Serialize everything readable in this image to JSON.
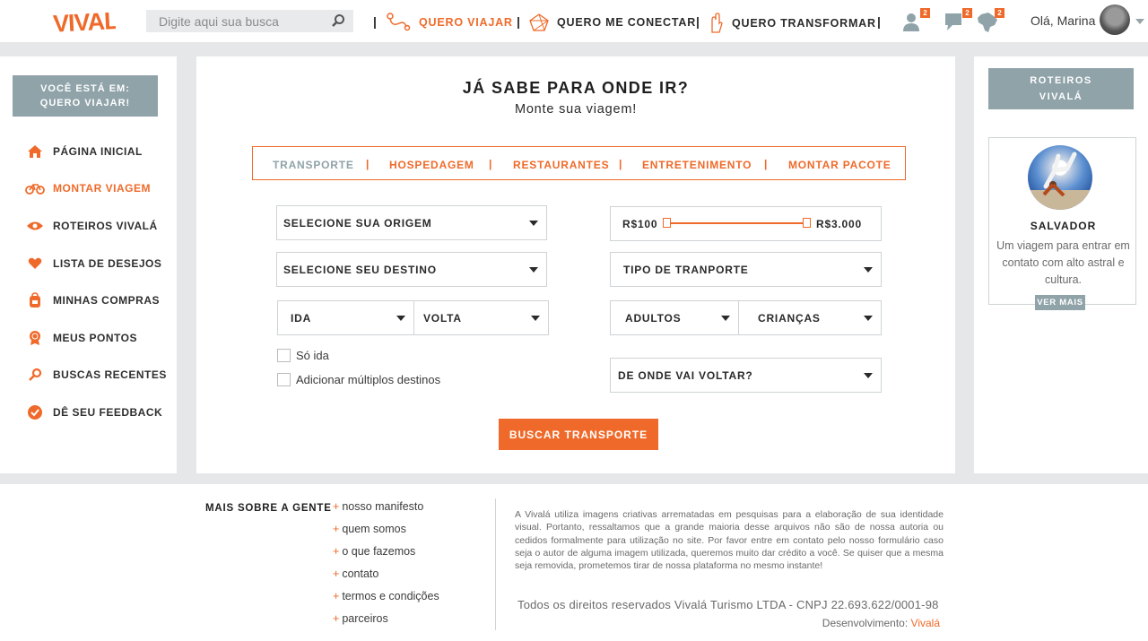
{
  "header": {
    "logo_text": "VIVALÁ",
    "search_placeholder": "Digite aqui sua busca",
    "nav": [
      {
        "label": "QUERO VIAJAR",
        "active": true
      },
      {
        "label": "QUERO ME CONECTAR",
        "active": false
      },
      {
        "label": "QUERO TRANSFORMAR",
        "active": false
      }
    ],
    "badges": {
      "profile": "2",
      "messages": "2",
      "map": "2"
    },
    "greeting": "Olá, Marina"
  },
  "sidebar": {
    "you_are_line1": "VOCÊ ESTÁ EM:",
    "you_are_line2": "QUERO VIAJAR!",
    "items": [
      {
        "label": "PÁGINA INICIAL",
        "icon": "home-icon"
      },
      {
        "label": "MONTAR VIAGEM",
        "icon": "bicycle-icon",
        "active": true
      },
      {
        "label": "ROTEIROS VIVALÁ",
        "icon": "eye-icon"
      },
      {
        "label": "LISTA DE DESEJOS",
        "icon": "heart-icon"
      },
      {
        "label": "MINHAS COMPRAS",
        "icon": "backpack-icon"
      },
      {
        "label": "MEUS PONTOS",
        "icon": "medal-icon"
      },
      {
        "label": "BUSCAS RECENTES",
        "icon": "search-icon"
      },
      {
        "label": "DÊ SEU FEEDBACK",
        "icon": "check-circle-icon"
      }
    ]
  },
  "main": {
    "title": "JÁ SABE PARA ONDE IR?",
    "subtitle": "Monte sua viagem!",
    "tabs": [
      "TRANSPORTE",
      "HOSPEDAGEM",
      "RESTAURANTES",
      "ENTRETENIMENTO",
      "MONTAR PACOTE"
    ],
    "origin": "SELECIONE SUA ORIGEM",
    "destination": "SELECIONE SEU DESTINO",
    "ida": "IDA",
    "volta": "VOLTA",
    "only_ida": "Só ida",
    "multi_dest": "Adicionar múltiplos destinos",
    "price_min": "R$100",
    "price_max": "R$3.000",
    "transport_type": "TIPO DE TRANPORTE",
    "adults": "ADULTOS",
    "children": "CRIANÇAS",
    "return_from": "DE ONDE VAI VOLTAR?",
    "submit": "BUSCAR TRANSPORTE"
  },
  "right": {
    "head_line1": "ROTEIROS",
    "head_line2": "VIVALÁ",
    "card_title": "SALVADOR",
    "card_text": "Um viagem para entrar em contato com alto astral e cultura.",
    "card_button": "VER MAIS"
  },
  "footer": {
    "heading": "MAIS SOBRE A GENTE",
    "links": [
      "nosso manifesto",
      "quem somos",
      "o que fazemos",
      "contato",
      "termos e condições",
      "parceiros"
    ],
    "disclaimer": "A Vivalá utiliza imagens criativas arrematadas em pesquisas para a elaboração de sua identidade visual. Portanto, ressaltamos que a grande maioria desse arquivos não são de nossa autoria ou cedidos formalmente para utilização no site. Por favor entre em contato pelo nosso formulário caso seja o autor de alguma imagem utilizada, queremos muito dar crédito a você. Se quiser que a mesma seja removida, prometemos tirar de nossa plataforma no mesmo instante!",
    "rights": "Todos os direitos reservados Vivalá Turismo LTDA   -   CNPJ 22.693.622/0001-98",
    "dev_label": "Desenvolvimento:",
    "dev_name": "Vivalá"
  },
  "colors": {
    "accent": "#ef6a2a",
    "slate": "#8fa3a9",
    "background": "#e6e7e8"
  }
}
